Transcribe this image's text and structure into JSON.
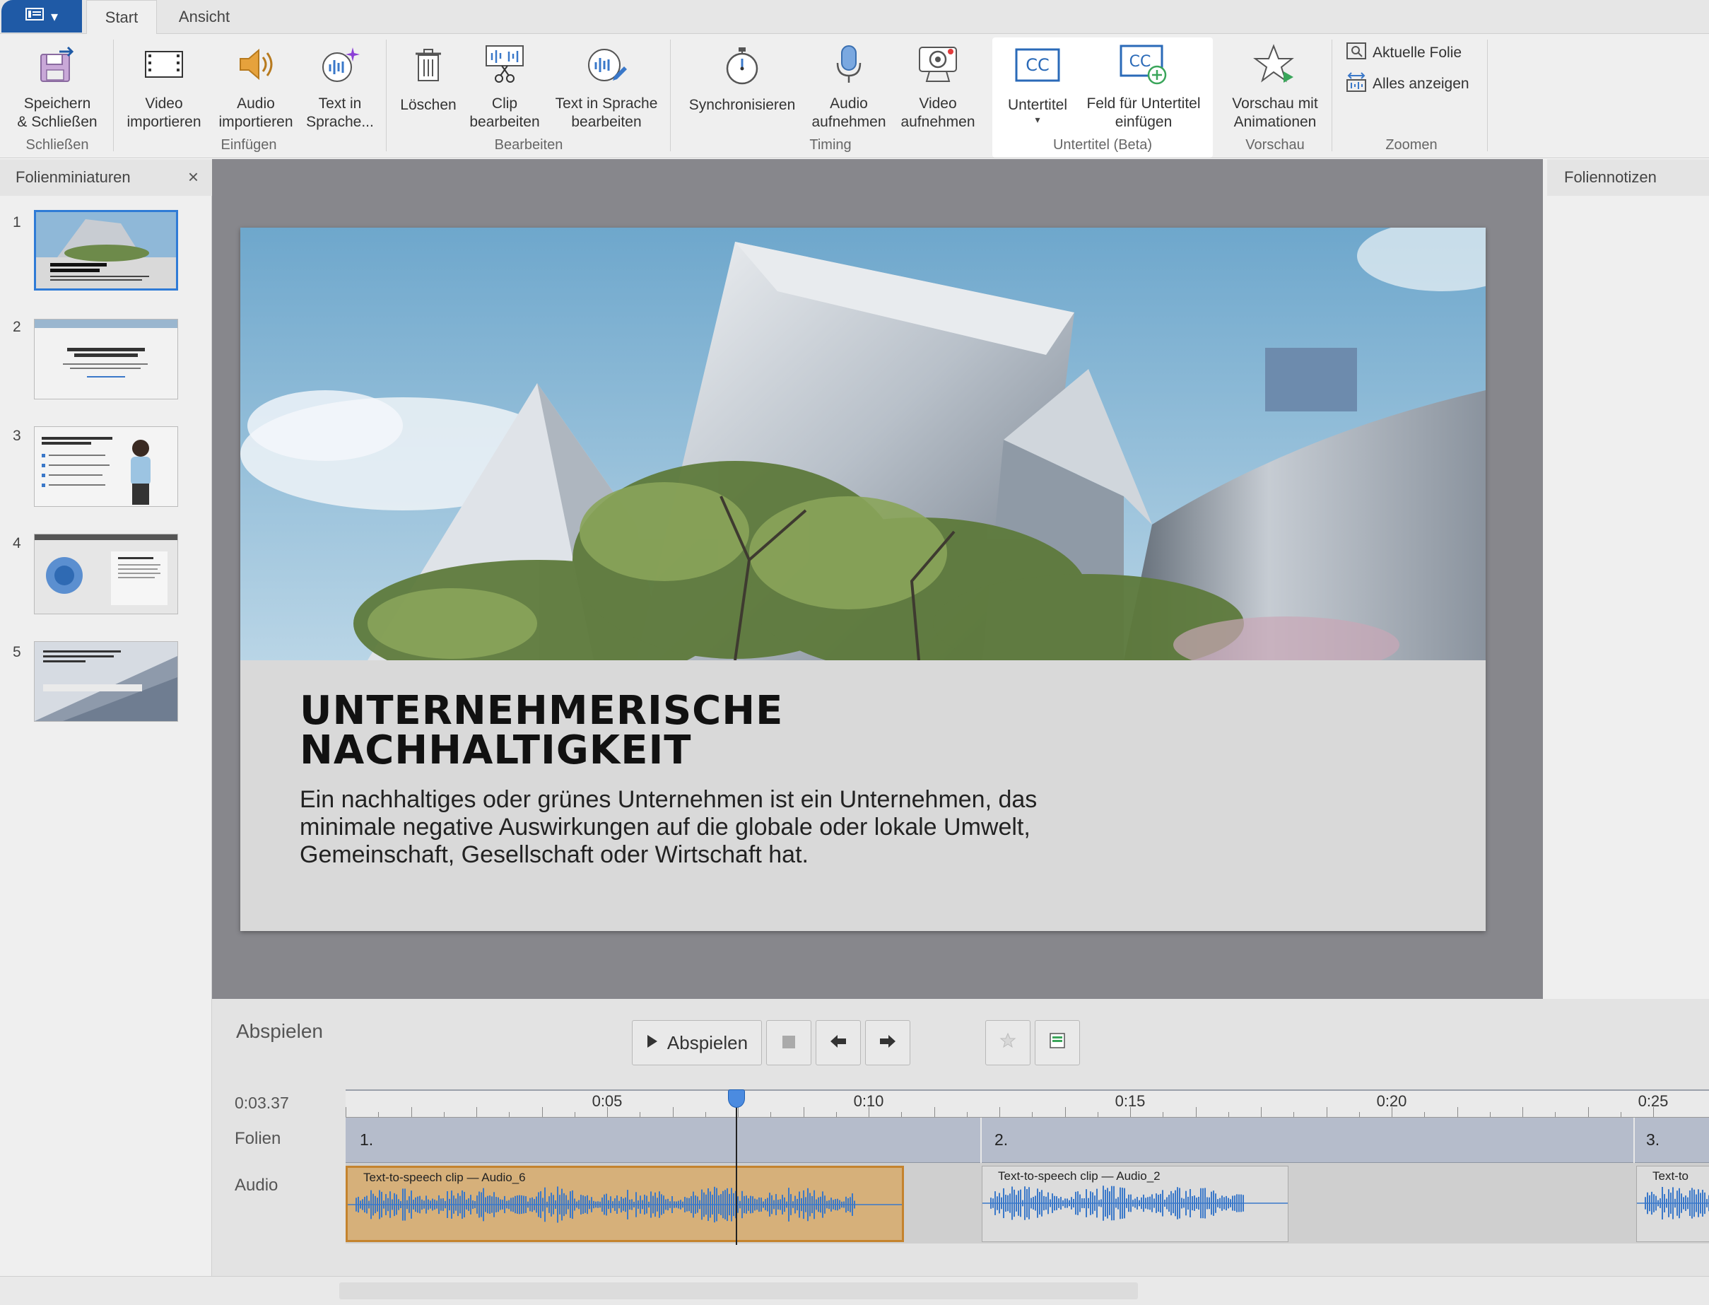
{
  "tabs": {
    "start": "Start",
    "view": "Ansicht"
  },
  "ribbon": {
    "save_close": "Speichern\n& Schließen",
    "video_import": "Video\nimportieren",
    "audio_import": "Audio\nimportieren",
    "text_speech": "Text in\nSprache...",
    "delete": "Löschen",
    "edit_clip": "Clip\nbearbeiten",
    "edit_tts": "Text in Sprache\nbearbeiten",
    "sync": "Synchronisieren",
    "record_audio": "Audio\naufnehmen",
    "record_video": "Video\naufnehmen",
    "subtitles": "Untertitel",
    "insert_subtitle_field": "Feld für Untertitel\neinfügen",
    "preview_anim": "Vorschau mit\nAnimationen",
    "current_slide": "Aktuelle Folie",
    "show_all": "Alles anzeigen",
    "groups": {
      "close": "Schließen",
      "insert": "Einfügen",
      "edit": "Bearbeiten",
      "timing": "Timing",
      "subtitles": "Untertitel (Beta)",
      "preview": "Vorschau",
      "zoom": "Zoomen"
    }
  },
  "left_panel": {
    "title": "Folienminiaturen",
    "close": "×",
    "thumbnails": [
      "1",
      "2",
      "3",
      "4",
      "5"
    ]
  },
  "slide": {
    "title": "UNTERNEHMERISCHE\nNACHHALTIGKEIT",
    "body": "Ein nachhaltiges oder grünes Unternehmen ist ein Unternehmen, das minimale negative Auswirkungen auf die globale oder lokale Umwelt, Gemeinschaft, Gesellschaft oder Wirtschaft hat."
  },
  "notes_panel": {
    "title": "Foliennotizen"
  },
  "timeline": {
    "title": "Abspielen",
    "play_button": "Abspielen",
    "time": "0:03.37",
    "ruler_labels": [
      "0:05",
      "0:10",
      "0:15",
      "0:20",
      "0:25"
    ],
    "rows": {
      "slides": "Folien",
      "audio": "Audio"
    },
    "slide_segments": [
      "1.",
      "2.",
      "3."
    ],
    "clips": [
      "Text-to-speech clip — Audio_6",
      "Text-to-speech clip — Audio_2",
      "Text-to"
    ]
  },
  "colors": {
    "accent": "#1f5aa6",
    "selection": "#2f7bd6",
    "clip_selected": "#d6b07a",
    "waveform": "#3a78c9"
  }
}
